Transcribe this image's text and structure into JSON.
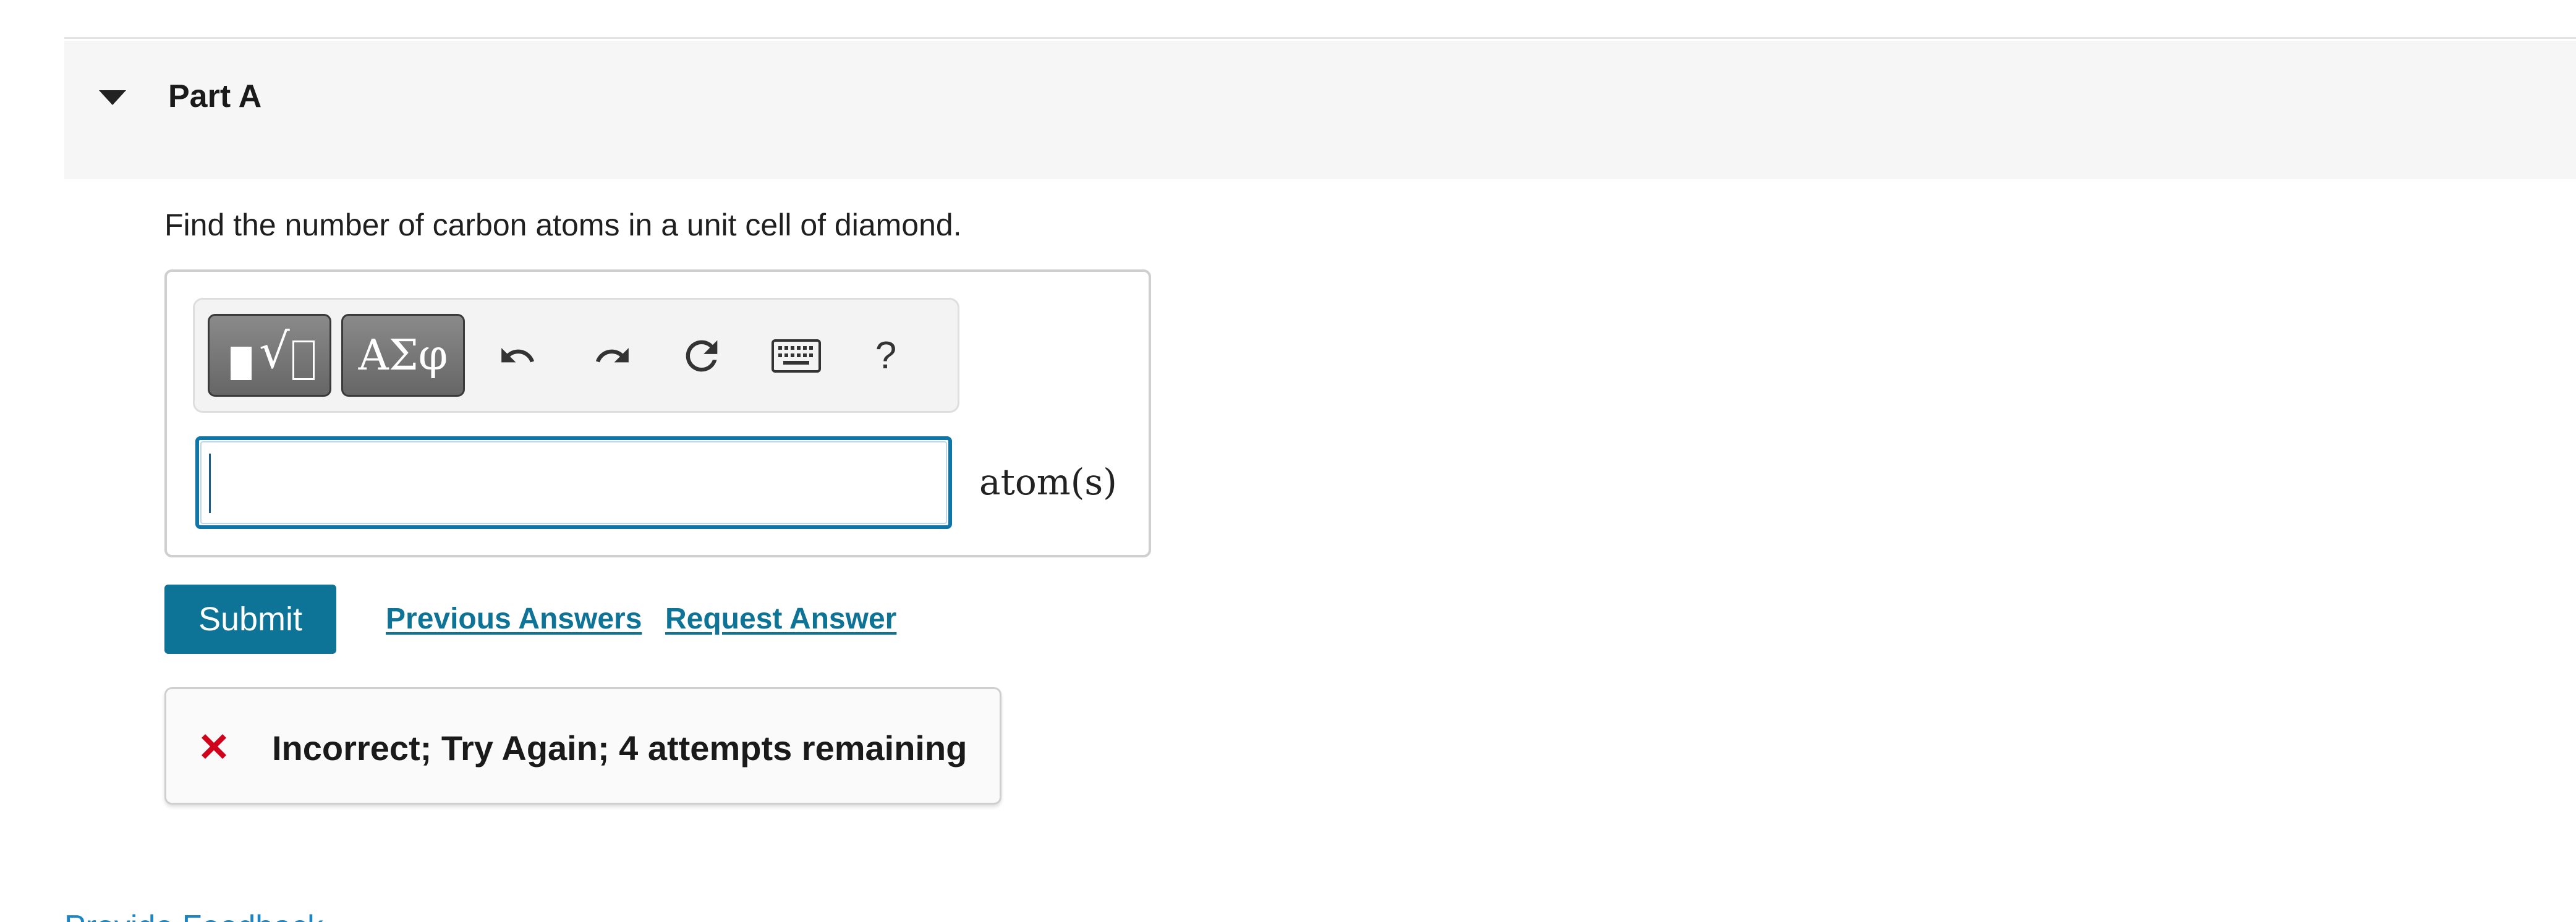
{
  "part": {
    "title": "Part A"
  },
  "question": {
    "text": "Find the number of carbon atoms in a unit cell of diamond."
  },
  "toolbar": {
    "templates_icon": "templates-root-icon",
    "symbols_label": "ΑΣφ",
    "undo_icon": "undo-icon",
    "redo_icon": "redo-icon",
    "reset_icon": "reset-icon",
    "keyboard_icon": "keyboard-icon",
    "help_label": "?"
  },
  "answer": {
    "value": "",
    "unit": "atom(s)"
  },
  "actions": {
    "submit_label": "Submit",
    "previous_answers_label": "Previous Answers",
    "request_answer_label": "Request Answer"
  },
  "feedback": {
    "icon": "x-icon",
    "message": "Incorrect; Try Again; 4 attempts remaining"
  },
  "footer": {
    "provide_feedback_label": "Provide Feedback"
  },
  "colors": {
    "accent": "#0e7497",
    "input_focus": "#0e76a8",
    "error": "#d0021b",
    "header_bg": "#f6f6f6",
    "link_blue": "#1a86c7"
  }
}
